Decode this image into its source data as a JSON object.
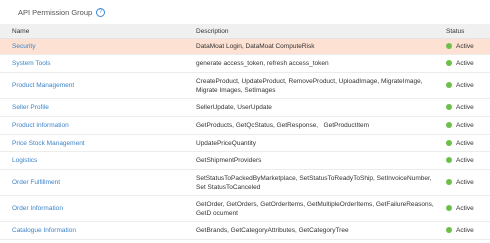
{
  "section": {
    "title": "API Permission Group",
    "help_icon": "question-circle-icon"
  },
  "table": {
    "headers": [
      "Name",
      "Description",
      "Status"
    ],
    "status_color": "#6cc04a",
    "selected_color": "#fde1d2",
    "rows": [
      {
        "name": "Security",
        "description": "DataMoat Login, DataMoat ComputeRisk",
        "status": "Active"
      },
      {
        "name": "System Tools",
        "description": "generate access_token, refresh access_token",
        "status": "Active"
      },
      {
        "name": "Product Management",
        "description": "CreateProduct, UpdateProduct, RemoveProduct, UploadImage, MigrateImage, Migrate Images, SetImages",
        "status": "Active"
      },
      {
        "name": "Seller Profile",
        "description": "SellerUpdate, UserUpdate",
        "status": "Active"
      },
      {
        "name": "Product Information",
        "description": "GetProducts, GetQcStatus, GetResponse,   GetProductItem",
        "status": "Active"
      },
      {
        "name": "Price Stock Management",
        "description": "UpdatePriceQuantity",
        "status": "Active"
      },
      {
        "name": "Logistics",
        "description": "GetShipmentProviders",
        "status": "Active"
      },
      {
        "name": "Order Fulfillment",
        "description": "SetStatusToPackedByMarketplace, SetStatusToReadyToShip, SetInvoiceNumber, Set StatusToCanceled",
        "status": "Active"
      },
      {
        "name": "Order Information",
        "description": "GetOrder, GetOrders, GetOrderItems, GetMultipleOrderItems, GetFailureReasons, GetD ocument",
        "status": "Active"
      },
      {
        "name": "Catalogue Information",
        "description": "GetBrands, GetCategoryAttributes, GetCategoryTree",
        "status": "Active"
      }
    ]
  }
}
